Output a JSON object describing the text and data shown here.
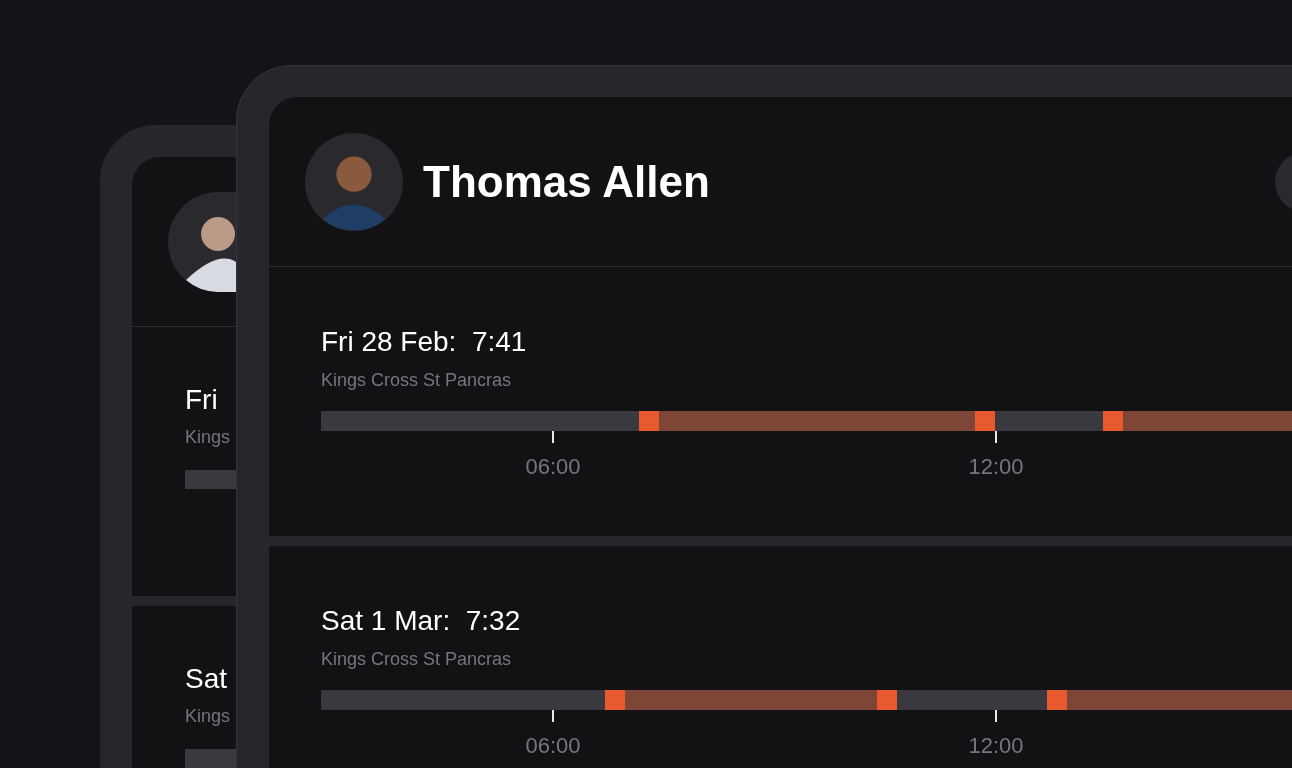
{
  "back_card": {
    "sections": [
      {
        "title": "Fri",
        "station": "Kings"
      },
      {
        "title": "Sat",
        "station": "Kings"
      }
    ]
  },
  "front_card": {
    "name": "Thomas Allen",
    "days": [
      {
        "title": "Fri 28 Feb:  7:41",
        "station": "Kings Cross St Pancras",
        "segments": [
          {
            "kind": "idle"
          },
          {
            "kind": "marker"
          },
          {
            "kind": "active"
          },
          {
            "kind": "marker"
          },
          {
            "kind": "idle"
          },
          {
            "kind": "marker"
          },
          {
            "kind": "active"
          }
        ],
        "ticks": [
          {
            "label": "06:00"
          },
          {
            "label": "12:00"
          }
        ]
      },
      {
        "title": "Sat 1 Mar:  7:32",
        "station": "Kings Cross St Pancras",
        "segments": [
          {
            "kind": "idle"
          },
          {
            "kind": "marker"
          },
          {
            "kind": "active"
          },
          {
            "kind": "marker"
          },
          {
            "kind": "idle"
          },
          {
            "kind": "marker"
          },
          {
            "kind": "active"
          }
        ],
        "ticks": [
          {
            "label": "06:00"
          },
          {
            "label": "12:00"
          }
        ]
      }
    ]
  }
}
